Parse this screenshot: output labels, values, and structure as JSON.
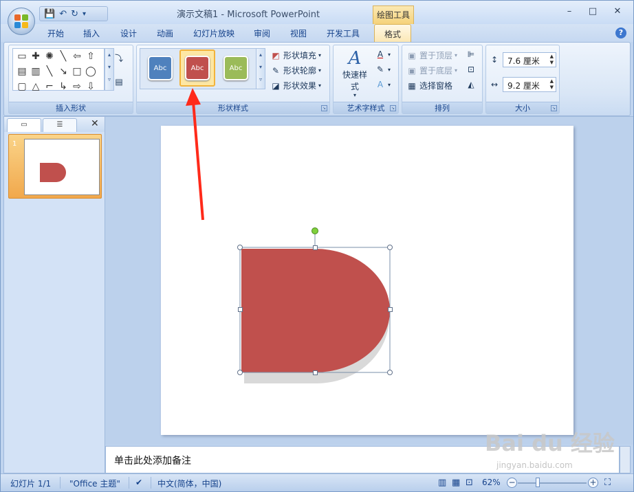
{
  "titlebar": {
    "title": "演示文稿1 - Microsoft PowerPoint",
    "contextual_tab": "绘图工具",
    "minimize": "–",
    "maximize": "□",
    "close": "✕"
  },
  "qat": {
    "save": "💾",
    "undo": "↶",
    "redo": "↻",
    "customize": "▾"
  },
  "tabs": [
    "开始",
    "插入",
    "设计",
    "动画",
    "幻灯片放映",
    "审阅",
    "视图",
    "开发工具",
    "格式"
  ],
  "active_tab": "格式",
  "ribbon": {
    "insert_shapes": {
      "label": "插入形状"
    },
    "shape_styles": {
      "label": "形状样式",
      "gallery": [
        {
          "text": "Abc",
          "color": "#4f81bd"
        },
        {
          "text": "Abc",
          "color": "#c0504d"
        },
        {
          "text": "Abc",
          "color": "#9bbb59"
        }
      ],
      "fill": "形状填充",
      "outline": "形状轮廓",
      "effects": "形状效果"
    },
    "wordart": {
      "label": "艺术字样式",
      "quick_styles": "快速样式"
    },
    "arrange": {
      "label": "排列",
      "bring_front": "置于顶层",
      "send_back": "置于底层",
      "selection_pane": "选择窗格"
    },
    "size": {
      "label": "大小",
      "height": "7.6 厘米",
      "width": "9.2 厘米"
    }
  },
  "slides_pane": {
    "slide_number": "1",
    "close": "✕"
  },
  "shape": {
    "fill_color": "#c0504d"
  },
  "notes": {
    "placeholder": "单击此处添加备注"
  },
  "status": {
    "slide": "幻灯片 1/1",
    "theme": "\"Office 主题\"",
    "language": "中文(简体，中国)",
    "zoom": "62%",
    "zoom_level": 0.62
  },
  "watermark": {
    "text": "Bai du 经验",
    "sub": "jingyan.baidu.com"
  }
}
